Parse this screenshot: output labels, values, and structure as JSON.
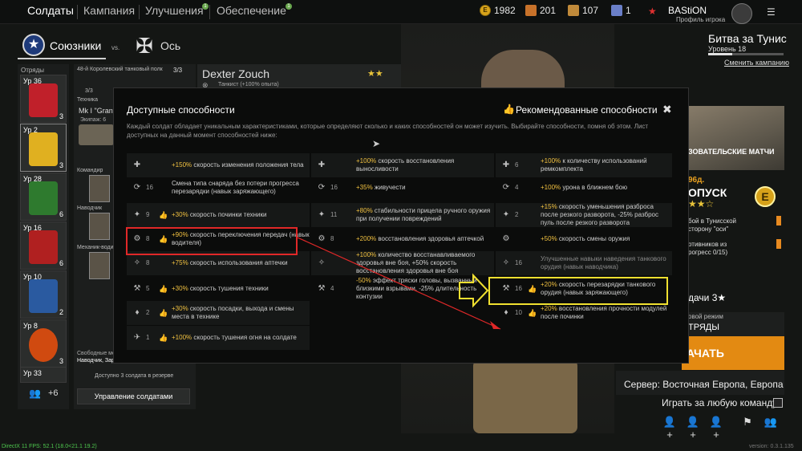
{
  "topnav": {
    "tabs": [
      "Солдаты",
      "Кампания",
      "Улучшения",
      "Обеспечение"
    ],
    "badges": [
      "1",
      "1"
    ]
  },
  "resources": [
    {
      "icon": "gold-coin-icon",
      "value": "1982"
    },
    {
      "icon": "orange-card-icon",
      "value": "201"
    },
    {
      "icon": "orange-card2-icon",
      "value": "107"
    },
    {
      "icon": "blue-card-icon",
      "value": "1"
    }
  ],
  "player": {
    "name": "BAStiON",
    "profile": "Профиль игрока"
  },
  "factions": {
    "allies": "Союзники",
    "vs": "vs.",
    "axis": "Ось"
  },
  "campaign": {
    "title": "Битва за Тунис",
    "level": "Уровень 18",
    "change": "Сменить кампанию"
  },
  "squads": {
    "label": "Отряды",
    "items": [
      {
        "level": "Ур 36",
        "count": "3",
        "color": "#c0202a"
      },
      {
        "level": "Ур 2",
        "count": "3",
        "color": "#e0b020"
      },
      {
        "level": "Ур 28",
        "count": "6",
        "color": "#2e7a2e"
      },
      {
        "level": "Ур 16",
        "count": "6",
        "color": "#b02020"
      },
      {
        "level": "Ур 10",
        "count": "2",
        "color": "#2a5aa0"
      },
      {
        "level": "Ур 8",
        "count": "3",
        "color": "#d04a10"
      },
      {
        "level": "Ур 33",
        "count": "",
        "color": "#2a4aa0"
      }
    ],
    "reserve_more": "+6"
  },
  "unit": {
    "title": "48-й Королевский танковый полк",
    "count": "3/3",
    "squad_size": "3/3",
    "tech_label": "Техника",
    "tech_name": "Mk I \"Grant\"",
    "crew": "Экипаж: 6",
    "roles": [
      "Командир",
      "Наводчик",
      "Механик-води"
    ],
    "free_label": "Свободные ме",
    "free_list": "Наводчик, Зар",
    "reserve": "Доступно 3 солдата в резерве",
    "manage": "Управление солдатами"
  },
  "soldier": {
    "name": "Dexter Zouch",
    "stars": "★★",
    "sub": "Танкист  (+100% опыта)"
  },
  "right": {
    "custom_matches": "ЗОВАТЕЛЬСКИЕ МАТЧИ",
    "price": "96д.",
    "pass": "ОПУСК",
    "pass_stars": "★★☆",
    "quests": [
      "бой в Тунисской\nсторону \"оси\"",
      "отивников из\nрогресс 0/15)"
    ],
    "tasks": "дачи 3★",
    "mode_sub": "овой режим",
    "mode_main": "ТРЯДЫ",
    "start": "АЧАТЬ",
    "server": "Сервер: Восточная Европа, Европа",
    "any_team": "Играть за любую команду"
  },
  "footer": {
    "fps": "DirectX 11  FPS: 52.1 (18.0<21.1 19.2)",
    "version": "version: 0.3.1.135"
  },
  "modal": {
    "title": "Доступные способности",
    "recommended": "Рекомендованные способности",
    "close": "✖",
    "description": "Каждый солдат обладает уникальным характеристиками, которые определяют сколько и каких способностей он может изучить. Выбирайте способности, помня об этом. Лист доступных на данный момент способностей ниже:",
    "col1": [
      {
        "num": "",
        "thumb": "",
        "pre": "",
        "hl": "+150%",
        "post": " скорость изменения положения тела"
      },
      {
        "num": "16",
        "thumb": "",
        "pre": "",
        "hl": "",
        "post": "Смена типа снаряда без потери прогресса перезарядки (навык заряжающего)"
      },
      {
        "num": "9",
        "thumb": "👍",
        "pre": "",
        "hl": "+30%",
        "post": " скорость починки техники"
      },
      {
        "num": "8",
        "thumb": "👍",
        "pre": "",
        "hl": "+90%",
        "post": " скорость переключения передач (навык водителя)"
      },
      {
        "num": "8",
        "thumb": "",
        "pre": "",
        "hl": "+75%",
        "post": " скорость использования аптечки"
      },
      {
        "num": "5",
        "thumb": "👍",
        "pre": "",
        "hl": "+30%",
        "post": " скорость тушения техники"
      },
      {
        "num": "2",
        "thumb": "👍",
        "pre": "",
        "hl": "+30%",
        "post": " скорость посадки, выхода и смены места в технике"
      },
      {
        "num": "1",
        "thumb": "👍",
        "pre": "",
        "hl": "+100%",
        "post": " скорость тушения огня на солдате"
      }
    ],
    "col2": [
      {
        "num": "",
        "thumb": "",
        "pre": "",
        "hl": "+100%",
        "post": " скорость восстановления выносливости"
      },
      {
        "num": "16",
        "thumb": "",
        "pre": "",
        "hl": "+35%",
        "post": " живучести"
      },
      {
        "num": "11",
        "thumb": "",
        "pre": "",
        "hl": "+80%",
        "post": " стабильности прицела ручного оружия при получении повреждений"
      },
      {
        "num": "8",
        "thumb": "",
        "pre": "",
        "hl": "+200%",
        "post": " восстановления здоровья аптечкой"
      },
      {
        "num": "",
        "thumb": "",
        "pre": "",
        "hl": "+100%",
        "post": " количество восстанавливаемого здоровья вне боя, +50% скорость восстановления здоровья вне боя"
      },
      {
        "num": "4",
        "thumb": "",
        "pre": "",
        "hl": "-50%",
        "post": " эффект тряски головы, вызванный близкими взрывами, -25% длительность контузии"
      }
    ],
    "col3": [
      {
        "num": "6",
        "thumb": "",
        "pre": "",
        "hl": "+100%",
        "post": " к количеству использований ремкомплекта"
      },
      {
        "num": "4",
        "thumb": "",
        "pre": "",
        "hl": "+100%",
        "post": " урона в ближнем бою"
      },
      {
        "num": "2",
        "thumb": "",
        "pre": "",
        "hl": "+15%",
        "post": " скорость уменьшения разброса после резкого разворота, -25% разброс пуль после резкого разворота"
      },
      {
        "num": "",
        "thumb": "",
        "pre": "",
        "hl": "+50%",
        "post": " скорость смены оружия"
      },
      {
        "num": "16",
        "thumb": "",
        "pre": "",
        "hl": "",
        "post": "Улучшенные навыки наведения танкового орудия (навык наводчика)"
      },
      {
        "num": "16",
        "thumb": "👍",
        "pre": "",
        "hl": "+20%",
        "post": " скорость перезарядки танкового орудия (навык заряжающего)"
      },
      {
        "num": "10",
        "thumb": "👍",
        "pre": "",
        "hl": "+20%",
        "post": " восстановления прочности модулей после починки"
      }
    ]
  }
}
